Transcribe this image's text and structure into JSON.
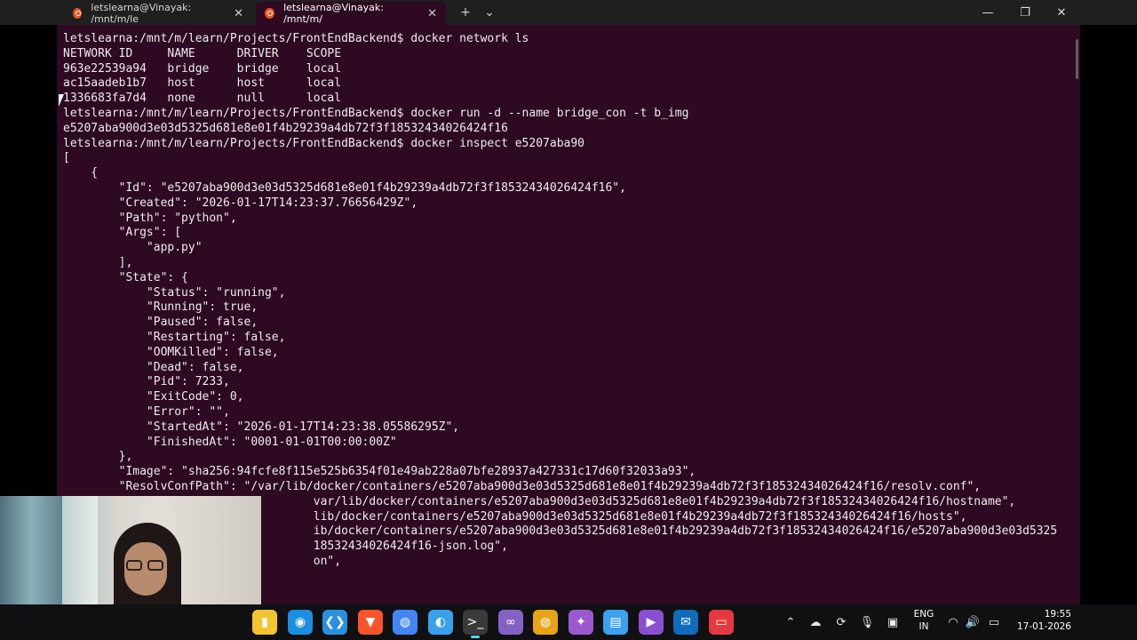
{
  "tabs": [
    {
      "label": "letslearna@Vinayak: /mnt/m/le",
      "active": false
    },
    {
      "label": "letslearna@Vinayak: /mnt/m/",
      "active": true
    }
  ],
  "tab_close_glyph": "✕",
  "new_tab_glyph": "+",
  "tab_menu_glyph": "⌄",
  "window_controls": {
    "minimize": "—",
    "maximize": "❐",
    "close": "✕"
  },
  "terminal": {
    "lines": [
      "letslearna:/mnt/m/learn/Projects/FrontEndBackend$ docker network ls",
      "NETWORK ID     NAME      DRIVER    SCOPE",
      "963e22539a94   bridge    bridge    local",
      "ac15aadeb1b7   host      host      local",
      "1336683fa7d4   none      null      local",
      "letslearna:/mnt/m/learn/Projects/FrontEndBackend$ docker run -d --name bridge_con -t b_img",
      "e5207aba900d3e03d5325d681e8e01f4b29239a4db72f3f18532434026424f16",
      "letslearna:/mnt/m/learn/Projects/FrontEndBackend$ docker inspect e5207aba90",
      "[",
      "    {",
      "        \"Id\": \"e5207aba900d3e03d5325d681e8e01f4b29239a4db72f3f18532434026424f16\",",
      "        \"Created\": \"2026-01-17T14:23:37.76656429Z\",",
      "        \"Path\": \"python\",",
      "        \"Args\": [",
      "            \"app.py\"",
      "        ],",
      "        \"State\": {",
      "            \"Status\": \"running\",",
      "            \"Running\": true,",
      "            \"Paused\": false,",
      "            \"Restarting\": false,",
      "            \"OOMKilled\": false,",
      "            \"Dead\": false,",
      "            \"Pid\": 7233,",
      "            \"ExitCode\": 0,",
      "            \"Error\": \"\",",
      "            \"StartedAt\": \"2026-01-17T14:23:38.05586295Z\",",
      "            \"FinishedAt\": \"0001-01-01T00:00:00Z\"",
      "        },",
      "        \"Image\": \"sha256:94fcfe8f115e525b6354f01e49ab228a07bfe28937a427331c17d60f32033a93\",",
      "        \"ResolvConfPath\": \"/var/lib/docker/containers/e5207aba900d3e03d5325d681e8e01f4b29239a4db72f3f18532434026424f16/resolv.conf\",",
      "                                    var/lib/docker/containers/e5207aba900d3e03d5325d681e8e01f4b29239a4db72f3f18532434026424f16/hostname\",",
      "                                    lib/docker/containers/e5207aba900d3e03d5325d681e8e01f4b29239a4db72f3f18532434026424f16/hosts\",",
      "                                    ib/docker/containers/e5207aba900d3e03d5325d681e8e01f4b29239a4db72f3f18532434026424f16/e5207aba900d3e03d5325",
      "                                    18532434026424f16-json.log\",",
      "                                    on\","
    ]
  },
  "taskbar": {
    "apps": [
      {
        "name": "file-explorer",
        "color": "#f4c430",
        "glyph": "▮"
      },
      {
        "name": "edge",
        "color": "#1b8ee0",
        "glyph": "◉"
      },
      {
        "name": "vscode",
        "color": "#2a8fe0",
        "glyph": "❮❯"
      },
      {
        "name": "brave",
        "color": "#fb542b",
        "glyph": "▼"
      },
      {
        "name": "chrome",
        "color": "#4285f4",
        "glyph": "◍"
      },
      {
        "name": "browser-blue",
        "color": "#39a0ed",
        "glyph": "◐"
      },
      {
        "name": "terminal",
        "color": "#3a3a3a",
        "glyph": ">_"
      },
      {
        "name": "visual-studio",
        "color": "#8661c5",
        "glyph": "∞"
      },
      {
        "name": "chrome-canary",
        "color": "#e8a317",
        "glyph": "◍"
      },
      {
        "name": "copilot",
        "color": "#9b59d0",
        "glyph": "✦"
      },
      {
        "name": "notepad",
        "color": "#3aa0f0",
        "glyph": "▤"
      },
      {
        "name": "clipchamp",
        "color": "#8a4fd0",
        "glyph": "▶"
      },
      {
        "name": "mail",
        "color": "#0f6cbd",
        "glyph": "✉"
      },
      {
        "name": "remote-desktop",
        "color": "#e6393f",
        "glyph": "▭"
      }
    ],
    "tray_icons": [
      "chevron-up-icon",
      "onedrive-icon",
      "sync-icon",
      "mic-icon",
      "screen-icon"
    ],
    "lang_line1": "ENG",
    "lang_line2": "IN",
    "time": "19:55",
    "date": "17-01-2026"
  }
}
